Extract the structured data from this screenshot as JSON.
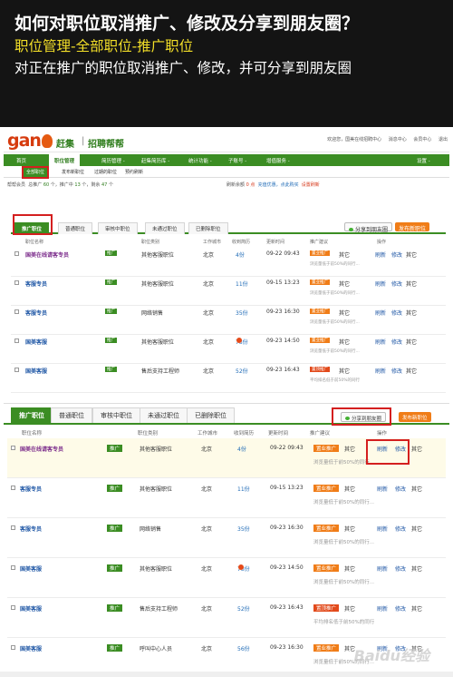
{
  "banner": {
    "title": "如何对职位取消推广、修改及分享到朋友圈？",
    "subtitle": "职位管理-全部职位-推广职位",
    "description": "对正在推广的职位取消推广、修改，并可分享到朋友圈"
  },
  "header": {
    "logo_text": "gan",
    "logo_text2": "ji",
    "logo_cn": "赶集",
    "separator": "|",
    "product": "招聘帮帮",
    "links": [
      "欢迎您，国美在线招聘中心",
      "消息中心",
      "会员中心",
      "退出"
    ]
  },
  "main_nav": [
    "首页",
    "职位管理",
    "简历管理 -",
    "赶集简历库 -",
    "统计功能 -",
    "子账号 -",
    "增值服务 -",
    "设置 -"
  ],
  "sub_nav": [
    "全部职位",
    "发布新职位",
    "过期的职位",
    "预约刷新"
  ],
  "stats": {
    "text1": "帮帮会员",
    "text2": "总推广",
    "total": "60",
    "text3": "个，推广中",
    "promoting": "13",
    "text4": "个，剩余",
    "remaining": "47",
    "text5": "个",
    "refresh_label": "刷新余额",
    "refresh_value": "0 点",
    "buy_link": "充值优惠，点此购买",
    "settings_link": "设置刷新"
  },
  "tabs": [
    "推广职位",
    "普通职位",
    "审核中职位",
    "未通过职位",
    "已删除职位"
  ],
  "share_button": "分享到朋友圈",
  "publish_button": "发布新职位",
  "columns": [
    "职位名称",
    "职位类别",
    "工作城市",
    "收到简历",
    "更新时间",
    "推广建议",
    "操作"
  ],
  "rows": [
    {
      "name": "国美在线请客专员",
      "tag": "推广",
      "category": "其他客服职位",
      "city": "北京",
      "resumes": "4份",
      "time": "09-22 09:43",
      "promo": "置业推广",
      "ops": [
        "刷新",
        "修改",
        "其它"
      ],
      "hint": "浏览量低于前50%的同行...",
      "badge": false
    },
    {
      "name": "客服专员",
      "tag": "推广",
      "category": "其他客服职位",
      "city": "北京",
      "resumes": "11份",
      "time": "09-15 13:23",
      "promo": "置业推广",
      "ops": [
        "刷新",
        "修改",
        "其它"
      ],
      "hint": "浏览量低于前50%的同行...",
      "badge": false
    },
    {
      "name": "客服专员",
      "tag": "推广",
      "category": "网络销售",
      "city": "北京",
      "resumes": "35份",
      "time": "09-23 16:30",
      "promo": "置业推广",
      "ops": [
        "刷新",
        "修改",
        "其它"
      ],
      "hint": "浏览量低于前50%的同行...",
      "badge": false
    },
    {
      "name": "国美客服",
      "tag": "推广",
      "category": "其他客服职位",
      "city": "北京",
      "resumes": "73份",
      "time": "09-23 14:50",
      "promo": "置业推广",
      "ops": [
        "刷新",
        "修改",
        "其它"
      ],
      "hint": "浏览量低于前50%的同行...",
      "badge": true
    },
    {
      "name": "国美客服",
      "tag": "推广",
      "category": "售后支持工程师",
      "city": "北京",
      "resumes": "52份",
      "time": "09-23 16:43",
      "promo": "置顶推广",
      "ops": [
        "刷新",
        "修改",
        "其它"
      ],
      "hint": "平均排名低于前50%的同行",
      "badge": false
    },
    {
      "name": "国美客服",
      "tag": "推广",
      "category": "呼叫中心人员",
      "city": "北京",
      "resumes": "56份",
      "time": "09-23 16:30",
      "promo": "置业推广",
      "ops": [
        "刷新",
        "修改",
        "其它"
      ],
      "hint": "浏览量低于前50%的同行...",
      "badge": false
    }
  ],
  "promo_more": "其它",
  "watermark": "Baidu经验",
  "colors": {
    "green": "#3b8d23",
    "orange": "#f07d18",
    "red_box": "#d41f1f",
    "link_blue": "#1e56a5"
  },
  "icons": [
    "wechat-icon",
    "checkbox-icon",
    "notification-badge-icon",
    "fire-logo-icon"
  ]
}
